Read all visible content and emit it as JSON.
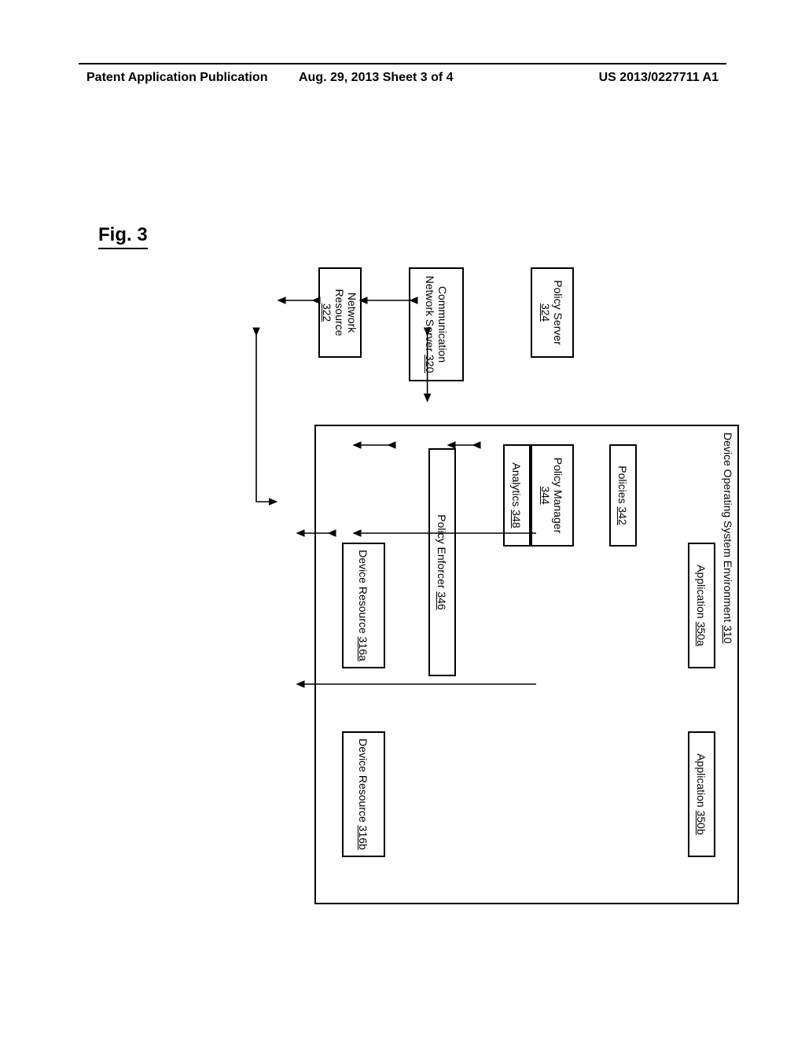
{
  "header": {
    "left": "Patent Application Publication",
    "center": "Aug. 29, 2013  Sheet 3 of 4",
    "right": "US 2013/0227711 A1"
  },
  "figure_label": "Fig. 3",
  "diagram": {
    "env_label": "Device Operating System Environment",
    "env_num": "310",
    "app_a": "Application",
    "app_a_num": "350a",
    "app_b": "Application",
    "app_b_num": "350b",
    "policies": "Policies",
    "policies_num": "342",
    "policy_mgr": "Policy Manager",
    "policy_mgr_num": "344",
    "analytics": "Analytics",
    "analytics_num": "348",
    "enforcer": "Policy Enforcer",
    "enforcer_num": "346",
    "resource_a": "Device Resource",
    "resource_a_num": "316a",
    "resource_b": "Device Resource",
    "resource_b_num": "316b",
    "policy_server": "Policy Server",
    "policy_server_num": "324",
    "comm_network": "Communication Network Server",
    "comm_network_num": "320",
    "net_resource": "Network Resource",
    "net_resource_num": "322"
  }
}
